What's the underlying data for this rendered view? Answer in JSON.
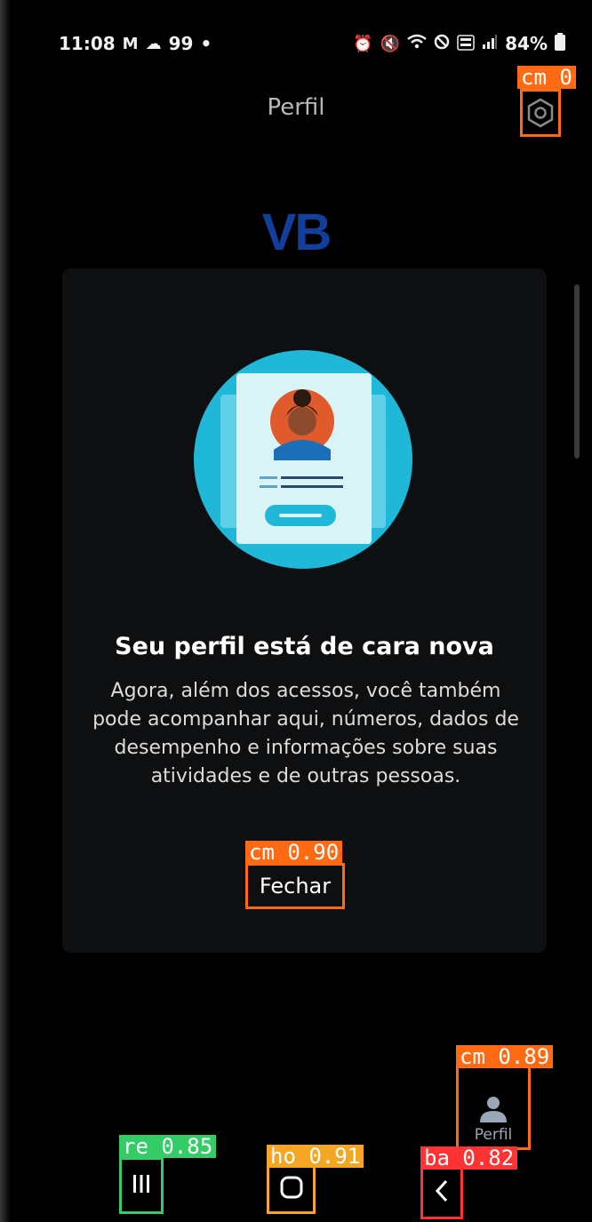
{
  "status_bar": {
    "time": "11:08",
    "left_icons": [
      "gmail-icon",
      "cloud-icon"
    ],
    "notif_count": "99",
    "dot": "•",
    "right_icons": [
      "alarm-icon",
      "mute-icon",
      "wifi-icon",
      "do-not-disturb-icon",
      "volte-icon",
      "signal-icon"
    ],
    "battery": "84%"
  },
  "header": {
    "title": "Perfil",
    "settings_icon": "settings-hex-icon",
    "settings_box_label": "cm 0"
  },
  "logo": {
    "text": "VB",
    "color": "#123e9c"
  },
  "modal": {
    "title": "Seu perfil está de cara nova",
    "body": "Agora, além dos acessos, você também pode acompanhar aqui, números, dados de desempenho e informações sobre suas atividades e de outras pessoas.",
    "close_label": "Fechar",
    "close_box_label": "cm 0.90",
    "illustration_icon": "profile-card-illustration"
  },
  "bottom_tab": {
    "label": "Perfil",
    "icon": "person-icon",
    "box_label": "cm 0.89"
  },
  "nav": {
    "recents_box_label": "re 0.85",
    "home_box_label": "ho 0.91",
    "back_box_label": "ba 0.82"
  },
  "colors": {
    "detection_orange": "#ff6a13",
    "detection_green": "#33cc66",
    "detection_yellow": "#f5a623",
    "detection_red": "#ff3333",
    "illustration_bg": "#1fb8d9"
  }
}
